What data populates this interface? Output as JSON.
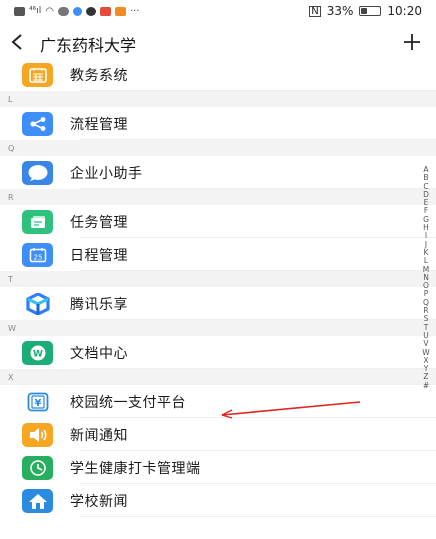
{
  "status_bar": {
    "battery_text": "33%",
    "battery_level": 0.33,
    "time": "10:20",
    "more": "···"
  },
  "header": {
    "back_icon": "chevron-left-icon",
    "title": "广东药科大学",
    "add_icon": "plus-icon"
  },
  "list": [
    {
      "type": "item",
      "label": "教务系统",
      "icon": "calendar-grid-icon",
      "color": "#f5a623"
    },
    {
      "type": "section",
      "label": "L"
    },
    {
      "type": "item",
      "label": "流程管理",
      "icon": "share-nodes-icon",
      "color": "#3e8ef7"
    },
    {
      "type": "section",
      "label": "Q"
    },
    {
      "type": "item",
      "label": "企业小助手",
      "icon": "chat-bubble-icon",
      "color": "#3a86e8"
    },
    {
      "type": "section",
      "label": "R"
    },
    {
      "type": "item",
      "label": "任务管理",
      "icon": "task-card-icon",
      "color": "#2ec27e"
    },
    {
      "type": "item",
      "label": "日程管理",
      "icon": "calendar-25-icon",
      "color": "#3e8ef7"
    },
    {
      "type": "section",
      "label": "T"
    },
    {
      "type": "item",
      "label": "腾讯乐享",
      "icon": "lexiang-logo-icon",
      "color": "#2d7df6"
    },
    {
      "type": "section",
      "label": "W"
    },
    {
      "type": "item",
      "label": "文档中心",
      "icon": "document-w-icon",
      "color": "#1aad78"
    },
    {
      "type": "section",
      "label": "X"
    },
    {
      "type": "item",
      "label": "校园统一支付平台",
      "icon": "yuan-payment-icon",
      "color": "#2a8be0"
    },
    {
      "type": "item",
      "label": "新闻通知",
      "icon": "speaker-icon",
      "color": "#f5a623"
    },
    {
      "type": "item",
      "label": "学生健康打卡管理端",
      "icon": "clock-icon",
      "color": "#27ae60"
    },
    {
      "type": "item",
      "label": "学校新闻",
      "icon": "home-icon",
      "color": "#2a8be0"
    }
  ],
  "index_letters": [
    "A",
    "B",
    "C",
    "D",
    "E",
    "F",
    "G",
    "H",
    "I",
    "J",
    "K",
    "L",
    "M",
    "N",
    "O",
    "P",
    "Q",
    "R",
    "S",
    "T",
    "U",
    "V",
    "W",
    "X",
    "Y",
    "Z",
    "#"
  ],
  "annotation": {
    "color": "#e02424"
  }
}
